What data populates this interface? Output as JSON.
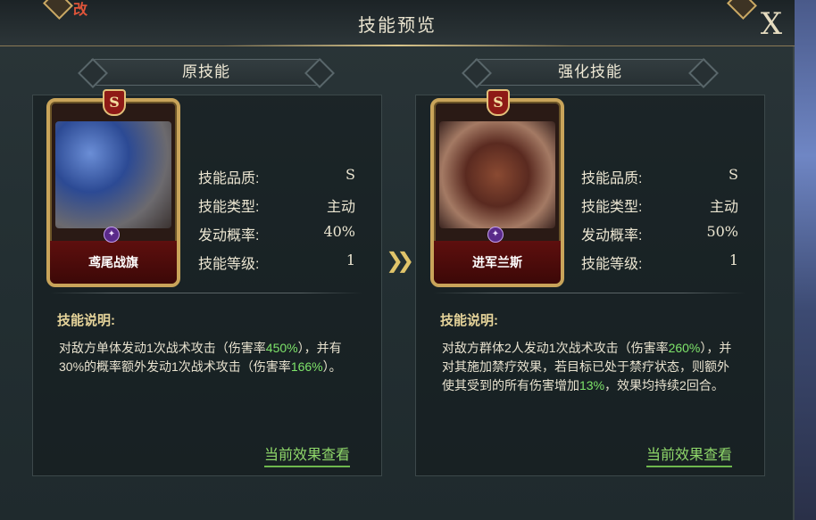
{
  "window": {
    "title": "技能预览",
    "close_label": "X",
    "corner_text": "改"
  },
  "original": {
    "banner": "原技能",
    "card": {
      "grade": "S",
      "name": "鸢尾战旗"
    },
    "stats": [
      {
        "label": "技能品质:",
        "value": "S"
      },
      {
        "label": "技能类型:",
        "value": "主动"
      },
      {
        "label": "发动概率:",
        "value": "40%"
      },
      {
        "label": "技能等级:",
        "value": "1"
      }
    ],
    "desc_title": "技能说明:",
    "desc_parts": [
      "对敌方单体发动1次战术攻击（伤害率",
      "450%",
      "），并有30%的概率额外发动1次战术攻击（伤害率",
      "166%",
      "）。"
    ],
    "link": "当前效果查看"
  },
  "enhanced": {
    "banner": "强化技能",
    "card": {
      "grade": "S",
      "name": "进军兰斯"
    },
    "stats": [
      {
        "label": "技能品质:",
        "value": "S"
      },
      {
        "label": "技能类型:",
        "value": "主动"
      },
      {
        "label": "发动概率:",
        "value": "50%"
      },
      {
        "label": "技能等级:",
        "value": "1"
      }
    ],
    "desc_title": "技能说明:",
    "desc_parts": [
      "对敌方群体2人发动1次战术攻击（伤害率",
      "260%",
      "），并对其施加禁疗效果，若目标已处于禁疗状态，则额外使其受到的所有伤害增加",
      "13%",
      "，效果均持续2回合。"
    ],
    "link": "当前效果查看"
  },
  "colors": {
    "highlight": "#7ee46a",
    "gold": "#c9a45a",
    "link": "#8fd86a"
  },
  "icons": {
    "close": "close-icon",
    "arrow": "double-chevron-right-icon",
    "card_icon": "purple-emblem-icon"
  }
}
